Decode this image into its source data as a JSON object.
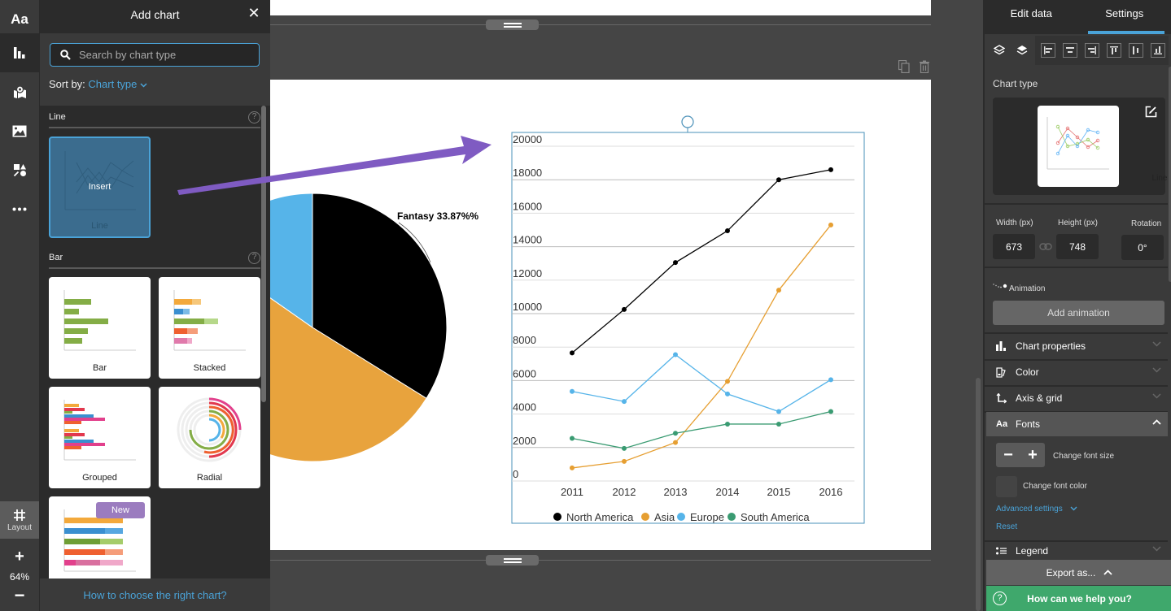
{
  "rail": {
    "items": [
      {
        "name": "text",
        "icon": "text-icon",
        "glyph": "Aa"
      },
      {
        "name": "charts",
        "icon": "bar-chart-icon",
        "active": true
      },
      {
        "name": "maps",
        "icon": "map-pin-icon"
      },
      {
        "name": "images",
        "icon": "image-icon"
      },
      {
        "name": "shapes",
        "icon": "shapes-icon"
      },
      {
        "name": "more",
        "icon": "more-icon"
      }
    ],
    "layout_label": "Layout",
    "zoom": {
      "plus": "+",
      "value": "64%",
      "minus": "−"
    }
  },
  "add_chart_panel": {
    "title": "Add chart",
    "close": "✕",
    "search": {
      "placeholder": "Search by chart type",
      "value": ""
    },
    "sort_label": "Sort by:",
    "sort_value": "Chart type",
    "sections": [
      {
        "title": "Line",
        "help": "?",
        "cards": [
          {
            "label": "Line",
            "hover_label": "Insert"
          }
        ]
      },
      {
        "title": "Bar",
        "help": "?",
        "cards": [
          {
            "label": "Bar"
          },
          {
            "label": "Stacked"
          },
          {
            "label": "Grouped"
          },
          {
            "label": "Radial"
          },
          {
            "label": "",
            "badge": "New"
          }
        ]
      }
    ],
    "footer_link": "How to choose the right chart?"
  },
  "canvas": {
    "pie_label": "Fantasy 33.87%%",
    "pie_colors": {
      "fantasy": "#000000",
      "orange": "#e8a33d",
      "blue": "#56b4e9"
    }
  },
  "chart_data": {
    "type": "line",
    "title": "",
    "xlabel": "",
    "ylabel": "",
    "categories": [
      "2011",
      "2012",
      "2013",
      "2014",
      "2015",
      "2016"
    ],
    "yticks": [
      "0",
      "2000",
      "4000",
      "6000",
      "8000",
      "10000",
      "12000",
      "14000",
      "16000",
      "18000",
      "20000"
    ],
    "ylim": [
      0,
      20000
    ],
    "grid": true,
    "legend_position": "bottom",
    "series": [
      {
        "name": "North America",
        "color": "#000000",
        "values": [
          7650,
          10250,
          13050,
          14950,
          18000,
          18600
        ]
      },
      {
        "name": "Asia",
        "color": "#e69f32",
        "values": [
          780,
          1170,
          2300,
          5950,
          11400,
          15300
        ]
      },
      {
        "name": "Europe",
        "color": "#56b4e9",
        "values": [
          5350,
          4750,
          7550,
          5200,
          4150,
          6050
        ]
      },
      {
        "name": "South America",
        "color": "#3a9b72",
        "values": [
          2550,
          1950,
          2850,
          3400,
          3400,
          4150
        ]
      }
    ]
  },
  "settings": {
    "tabs": [
      {
        "label": "Edit data"
      },
      {
        "label": "Settings",
        "active": true
      }
    ],
    "chart_type_label": "Chart type",
    "chart_type_value": "Line",
    "width_label": "Width (px)",
    "height_label": "Height (px)",
    "rotation_label": "Rotation",
    "width_value": "673",
    "height_value": "748",
    "rotation_value": "0°",
    "animation_label": "Animation",
    "add_animation": "Add animation",
    "accordions": [
      {
        "label": "Chart properties",
        "icon": "bar-chart-icon"
      },
      {
        "label": "Color",
        "icon": "palette-icon"
      },
      {
        "label": "Axis & grid",
        "icon": "axis-icon"
      },
      {
        "label": "Fonts",
        "icon": "font-icon",
        "open": true
      },
      {
        "label": "Legend",
        "icon": "legend-icon"
      }
    ],
    "fonts": {
      "change_size": "Change font size",
      "change_color": "Change font color",
      "advanced": "Advanced settings",
      "reset": "Reset",
      "minus": "−",
      "plus": "+"
    },
    "export_label": "Export as...",
    "help_label": "How can we help you?",
    "accent": "#4aa3d8",
    "help_color": "#3fa86c"
  }
}
